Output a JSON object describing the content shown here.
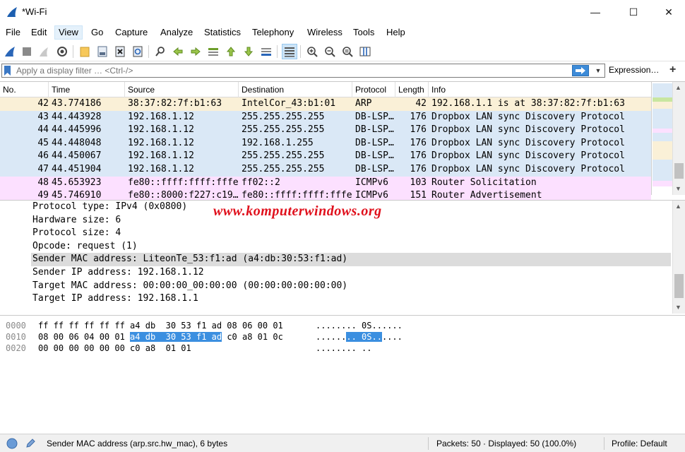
{
  "window": {
    "title": "*Wi-Fi",
    "minimize": "—",
    "maximize": "☐",
    "close": "✕"
  },
  "menu": [
    "File",
    "Edit",
    "View",
    "Go",
    "Capture",
    "Analyze",
    "Statistics",
    "Telephony",
    "Wireless",
    "Tools",
    "Help"
  ],
  "filter": {
    "placeholder": "Apply a display filter … <Ctrl-/>",
    "value": "",
    "expression_label": "Expression…",
    "add_label": "+"
  },
  "packet_list": {
    "columns": [
      "No.",
      "Time",
      "Source",
      "Destination",
      "Protocol",
      "Length",
      "Info"
    ],
    "rows": [
      {
        "no": "42",
        "time": "43.774186",
        "source": "38:37:82:7f:b1:63",
        "destination": "IntelCor_43:b1:01",
        "protocol": "ARP",
        "length": "42",
        "info": "192.168.1.1 is at 38:37:82:7f:b1:63",
        "color": "#faf0d7"
      },
      {
        "no": "43",
        "time": "44.443928",
        "source": "192.168.1.12",
        "destination": "255.255.255.255",
        "protocol": "DB-LSP…",
        "length": "176",
        "info": "Dropbox LAN sync Discovery Protocol",
        "color": "#dae8f6"
      },
      {
        "no": "44",
        "time": "44.445996",
        "source": "192.168.1.12",
        "destination": "255.255.255.255",
        "protocol": "DB-LSP…",
        "length": "176",
        "info": "Dropbox LAN sync Discovery Protocol",
        "color": "#dae8f6"
      },
      {
        "no": "45",
        "time": "44.448048",
        "source": "192.168.1.12",
        "destination": "192.168.1.255",
        "protocol": "DB-LSP…",
        "length": "176",
        "info": "Dropbox LAN sync Discovery Protocol",
        "color": "#dae8f6"
      },
      {
        "no": "46",
        "time": "44.450067",
        "source": "192.168.1.12",
        "destination": "255.255.255.255",
        "protocol": "DB-LSP…",
        "length": "176",
        "info": "Dropbox LAN sync Discovery Protocol",
        "color": "#dae8f6"
      },
      {
        "no": "47",
        "time": "44.451904",
        "source": "192.168.1.12",
        "destination": "255.255.255.255",
        "protocol": "DB-LSP…",
        "length": "176",
        "info": "Dropbox LAN sync Discovery Protocol",
        "color": "#dae8f6"
      },
      {
        "no": "48",
        "time": "45.653923",
        "source": "fe80::ffff:ffff:fffe",
        "destination": "ff02::2",
        "protocol": "ICMPv6",
        "length": "103",
        "info": "Router Solicitation",
        "color": "#fce0ff"
      },
      {
        "no": "49",
        "time": "45.746910",
        "source": "fe80::8000:f227:c19…",
        "destination": "fe80::ffff:ffff:fffe",
        "protocol": "ICMPv6",
        "length": "151",
        "info": "Router Advertisement",
        "color": "#fce0ff"
      }
    ]
  },
  "details": {
    "watermark": "www.komputerwindows.org",
    "lines": [
      "Protocol type: IPv4 (0x0800)",
      "Hardware size: 6",
      "Protocol size: 4",
      "Opcode: request (1)",
      "Sender MAC address: LiteonTe_53:f1:ad (a4:db:30:53:f1:ad)",
      "Sender IP address: 192.168.1.12",
      "Target MAC address: 00:00:00_00:00:00 (00:00:00:00:00:00)",
      "Target IP address: 192.168.1.1"
    ]
  },
  "bytes": {
    "rows": [
      {
        "offset": "0000",
        "hex_a": "ff ff ff ff ff ff a4 db  30 53 f1 ad 08 06 00 01",
        "hex_hl": "",
        "hex_b": "",
        "ascii_a": "........ 0S......",
        "ascii_hl": "",
        "ascii_b": ""
      },
      {
        "offset": "0010",
        "hex_a": "08 00 06 04 00 01 ",
        "hex_hl": "a4 db  30 53 f1 ad",
        "hex_b": " c0 a8 01 0c",
        "ascii_a": "......",
        "ascii_hl": ".. 0S..",
        "ascii_b": "...."
      },
      {
        "offset": "0020",
        "hex_a": "00 00 00 00 00 00 c0 a8  01 01",
        "hex_hl": "",
        "hex_b": "",
        "ascii_a": "........ ..",
        "ascii_hl": "",
        "ascii_b": ""
      }
    ]
  },
  "status": {
    "field": "Sender MAC address (arp.src.hw_mac), 6 bytes",
    "packets": "Packets: 50 · Displayed: 50 (100.0%)",
    "profile": "Profile: Default"
  }
}
